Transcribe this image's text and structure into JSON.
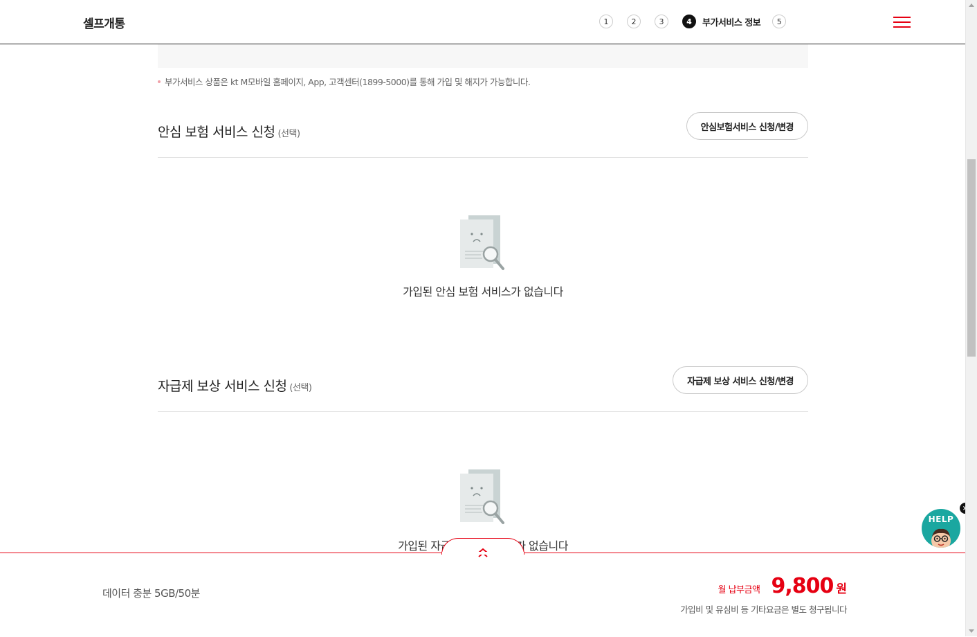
{
  "header": {
    "title": "셀프개통",
    "steps": [
      {
        "number": "1"
      },
      {
        "number": "2"
      },
      {
        "number": "3"
      },
      {
        "number": "4",
        "label": "부가서비스 정보"
      },
      {
        "number": "5"
      }
    ]
  },
  "notice": "부가서비스 상품은 kt M모바일 홈페이지, App, 고객센터(1899-5000)를 통해 가입 및 해지가 가능합니다.",
  "insurance_section": {
    "title": "안심 보험 서비스 신청",
    "optional": "(선택)",
    "button": "안심보험서비스 신청/변경",
    "empty_text": "가입된 안심 보험 서비스가 없습니다"
  },
  "compensation_section": {
    "title": "자급제 보상 서비스 신청",
    "optional": "(선택)",
    "button": "자급제 보상 서비스 신청/변경",
    "empty_text": "가입된 자급제 보상 서비스가 없습니다"
  },
  "bottom_bar": {
    "plan": "데이터 충분 5GB/50분",
    "price_label": "월 납부금액",
    "price_value": "9,800",
    "price_unit": "원",
    "price_note": "가입비 및 유심비 등 기타요금은 별도 청구됩니다"
  },
  "help": {
    "label": "HELP",
    "close": "×"
  },
  "colors": {
    "accent": "#e60012",
    "help_bg": "#1aa7a0"
  },
  "icons": {
    "menu": "hamburger-menu-icon",
    "empty": "document-search-sad-icon",
    "collapse": "double-chevron-up-icon"
  }
}
